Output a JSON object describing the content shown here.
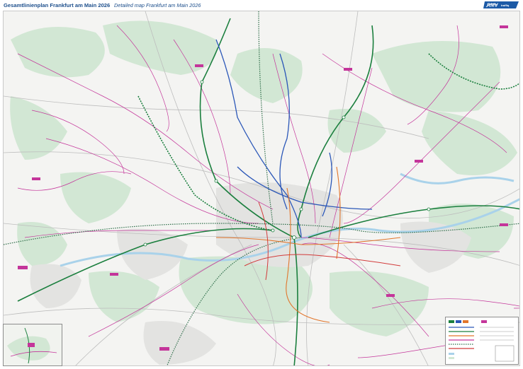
{
  "header": {
    "title": "Gesamtlinienplan Frankfurt am Main 2026",
    "subtitle": "Detailed map Frankfurt am Main 2026"
  },
  "logo": {
    "text": "RMV",
    "tagline": "traffiq",
    "colors": {
      "background": "#1c5aa6",
      "accent": "#e2007a"
    }
  },
  "map": {
    "colors": {
      "background": "#f4f4f2",
      "forest": "#d2e7d4",
      "water": "#a9d2ea",
      "bus": "#c4359a",
      "s_bahn": "#1b7f3e",
      "regional_rail": "#2f6e4a",
      "u_bahn": "#2b57b8",
      "tram": "#e2762c",
      "tram_alt": "#d23a3a",
      "roads": "#bdbdbd"
    }
  }
}
